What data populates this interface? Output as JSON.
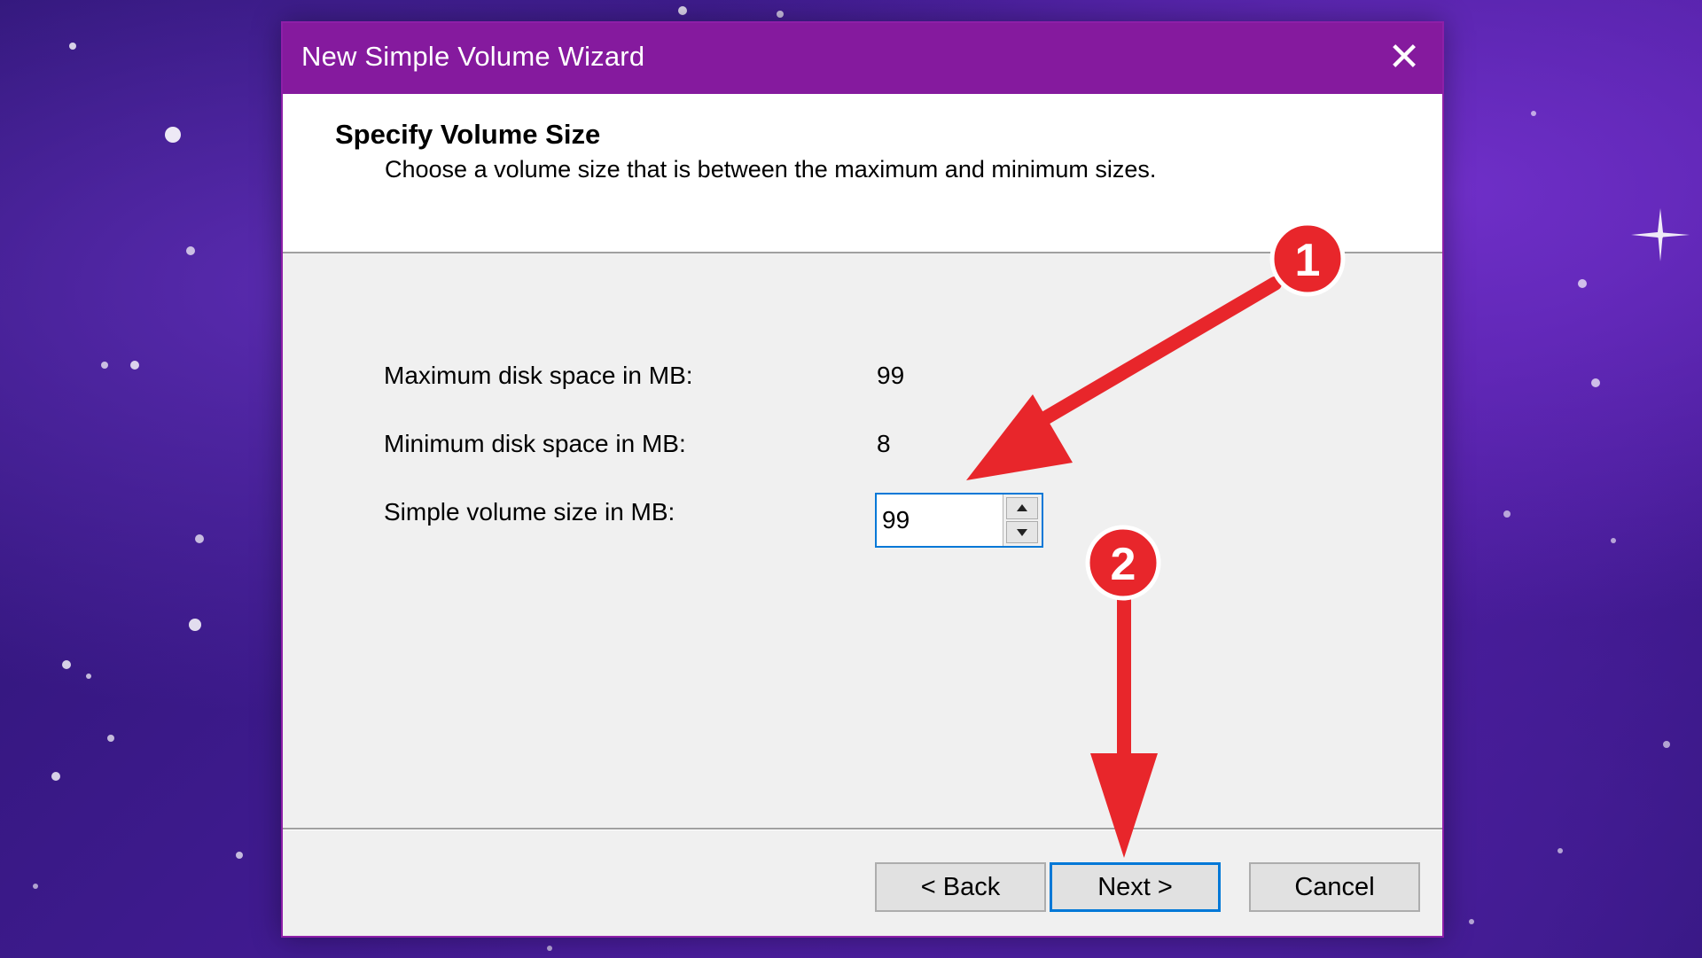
{
  "dialog": {
    "title": "New Simple Volume Wizard",
    "close_glyph": "✕"
  },
  "header": {
    "title": "Specify Volume Size",
    "subtitle": "Choose a volume size that is between the maximum and minimum sizes."
  },
  "fields": {
    "max_label": "Maximum disk space in MB:",
    "max_value": "99",
    "min_label": "Minimum disk space in MB:",
    "min_value": "8",
    "size_label": "Simple volume size in MB:",
    "size_value": "99"
  },
  "buttons": {
    "back": "< Back",
    "next": "Next >",
    "cancel": "Cancel"
  },
  "annotations": {
    "step1": "1",
    "step2": "2",
    "arrow_color": "#e8262b"
  },
  "colors": {
    "titlebar": "#851a9e",
    "focus_border": "#0078d7"
  }
}
